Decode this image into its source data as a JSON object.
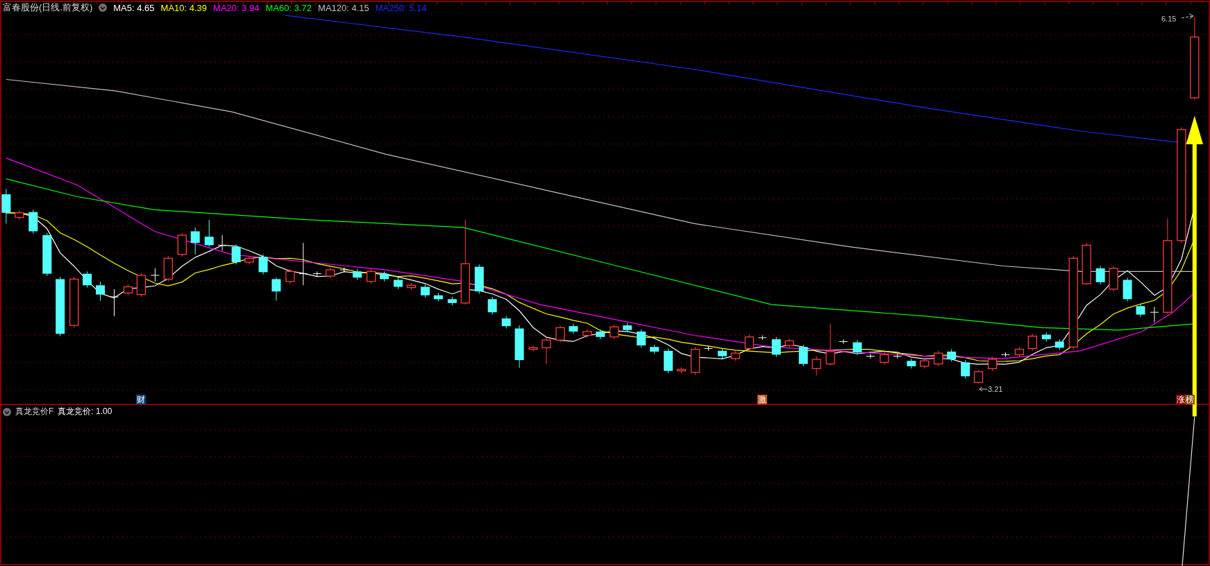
{
  "main_panel": {
    "title": "富春股份(日线.前复权)",
    "moving_averages": [
      {
        "label": "MA5: 4.65",
        "color": "#ffffff"
      },
      {
        "label": "MA10: 4.39",
        "color": "#ffff00"
      },
      {
        "label": "MA20: 3.94",
        "color": "#ff00ff"
      },
      {
        "label": "MA60: 3.72",
        "color": "#00ff00"
      },
      {
        "label": "MA120: 4.15",
        "color": "#c0c0c0"
      },
      {
        "label": "MA250: 5.14",
        "color": "#1c2cff"
      }
    ],
    "high_label": "6.15",
    "low_label": "3.21",
    "markers": [
      {
        "text": "财",
        "color": "#0e4a80"
      },
      {
        "text": "激",
        "color": "#c8501a"
      },
      {
        "text": "涨",
        "color": "#8b0000"
      },
      {
        "text": "榜",
        "color": "#8b4a10"
      }
    ]
  },
  "indicator_panel": {
    "title": "真龙竞价F",
    "reading": "真龙竞价: 1.00"
  }
}
